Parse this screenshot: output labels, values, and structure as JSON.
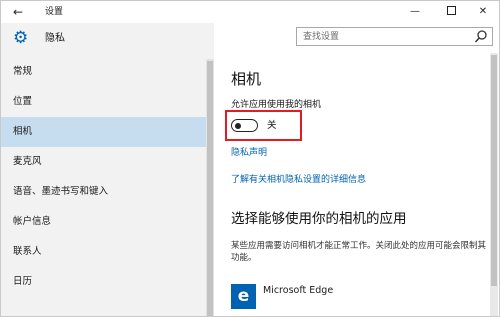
{
  "window": {
    "title": "设置",
    "back_glyph": "←",
    "minimize_glyph": "—",
    "close_glyph": "✕"
  },
  "sidebar": {
    "header_title": "隐私",
    "header_icon": "gear-icon",
    "items": [
      {
        "label": "常规"
      },
      {
        "label": "位置"
      },
      {
        "label": "相机",
        "active": true
      },
      {
        "label": "麦克风"
      },
      {
        "label": "语音、墨迹书写和键入"
      },
      {
        "label": "帐户信息"
      },
      {
        "label": "联系人"
      },
      {
        "label": "日历"
      }
    ]
  },
  "search": {
    "placeholder": "查找设置",
    "icon": "search-icon"
  },
  "content": {
    "heading": "相机",
    "allow_label": "允许应用使用我的相机",
    "toggle_state": "关",
    "toggle_on": false,
    "privacy_link": "隐私声明",
    "learn_more_link": "了解有关相机隐私设置的详细信息",
    "apps_heading": "选择能够使用你的相机的应用",
    "apps_description": "某些应用需要访问相机才能正常工作。关闭此处的应用可能会限制其功能。",
    "apps": [
      {
        "name": "Microsoft Edge",
        "icon": "edge-icon",
        "icon_glyph": "e"
      }
    ]
  },
  "colors": {
    "accent": "#0063b1",
    "sidebar_bg": "#f2f2f2",
    "active_item_bg": "#c6dcef",
    "highlight_box": "#e51b23"
  }
}
